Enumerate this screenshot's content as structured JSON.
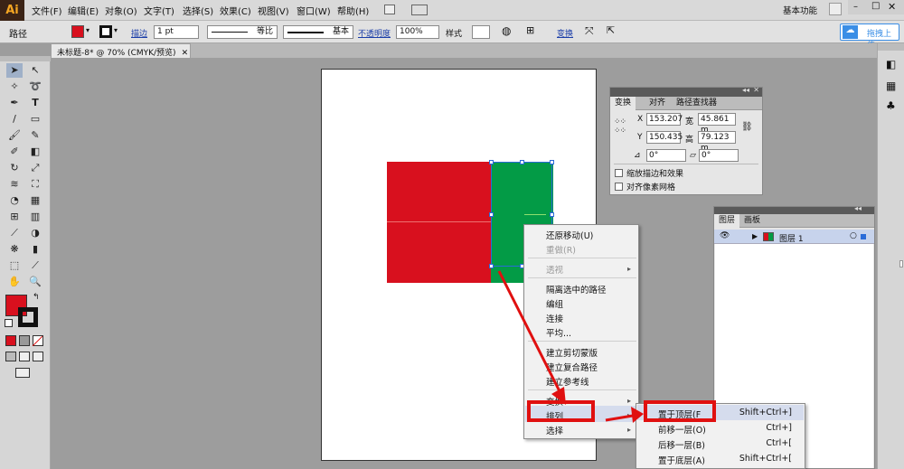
{
  "app": {
    "logo": "Ai",
    "menus": [
      "文件(F)",
      "编辑(E)",
      "对象(O)",
      "文字(T)",
      "选择(S)",
      "效果(C)",
      "视图(V)",
      "窗口(W)",
      "帮助(H)"
    ],
    "workspace": "基本功能",
    "upload_label": "拖拽上传"
  },
  "control": {
    "path_label": "路径",
    "stroke_label": "描边",
    "stroke_weight": "1 pt",
    "profile_label": "等比",
    "brush_label": "基本",
    "opacity_label": "不透明度",
    "opacity_value": "100%",
    "style_label": "样式",
    "transform_label": "变换"
  },
  "document": {
    "tab_title": "未标题-8* @ 70% (CMYK/预览)"
  },
  "colors": {
    "red": "#d8101e",
    "green": "#039b46",
    "accent": "#e01010",
    "selection": "#2a6bd8"
  },
  "transform_panel": {
    "tabs": [
      "变换",
      "对齐",
      "路径查找器"
    ],
    "x_label": "X",
    "x_value": "153.207",
    "w_label": "宽",
    "w_value": "45.861 m",
    "y_label": "Y",
    "y_value": "150.435",
    "h_label": "高",
    "h_value": "79.123 m",
    "angle_value": "0°",
    "shear_value": "0°",
    "opt1": "缩放描边和效果",
    "opt2": "对齐像素网格"
  },
  "layers_panel": {
    "tabs": [
      "图层",
      "画板"
    ],
    "layer_name": "图层 1"
  },
  "context_menu": {
    "items": [
      {
        "label": "还原移动(U)",
        "disabled": false
      },
      {
        "label": "重做(R)",
        "disabled": true
      },
      {
        "label": "透视",
        "disabled": true,
        "submenu": true
      },
      {
        "label": "隔离选中的路径",
        "disabled": false
      },
      {
        "label": "编组",
        "disabled": false
      },
      {
        "label": "连接",
        "disabled": false
      },
      {
        "label": "平均...",
        "disabled": false
      },
      {
        "label": "建立剪切蒙版",
        "disabled": false
      },
      {
        "label": "建立复合路径",
        "disabled": false
      },
      {
        "label": "建立参考线",
        "disabled": false
      },
      {
        "label": "变换",
        "disabled": false,
        "submenu": true
      },
      {
        "label": "排列",
        "disabled": false,
        "submenu": true
      },
      {
        "label": "选择",
        "disabled": false,
        "submenu": true
      }
    ]
  },
  "arrange_submenu": {
    "items": [
      {
        "label": "置于顶层(F",
        "shortcut": "Shift+Ctrl+]"
      },
      {
        "label": "前移一层(O)",
        "shortcut": "Ctrl+]"
      },
      {
        "label": "后移一层(B)",
        "shortcut": "Ctrl+["
      },
      {
        "label": "置于底层(A)",
        "shortcut": "Shift+Ctrl+["
      }
    ]
  }
}
